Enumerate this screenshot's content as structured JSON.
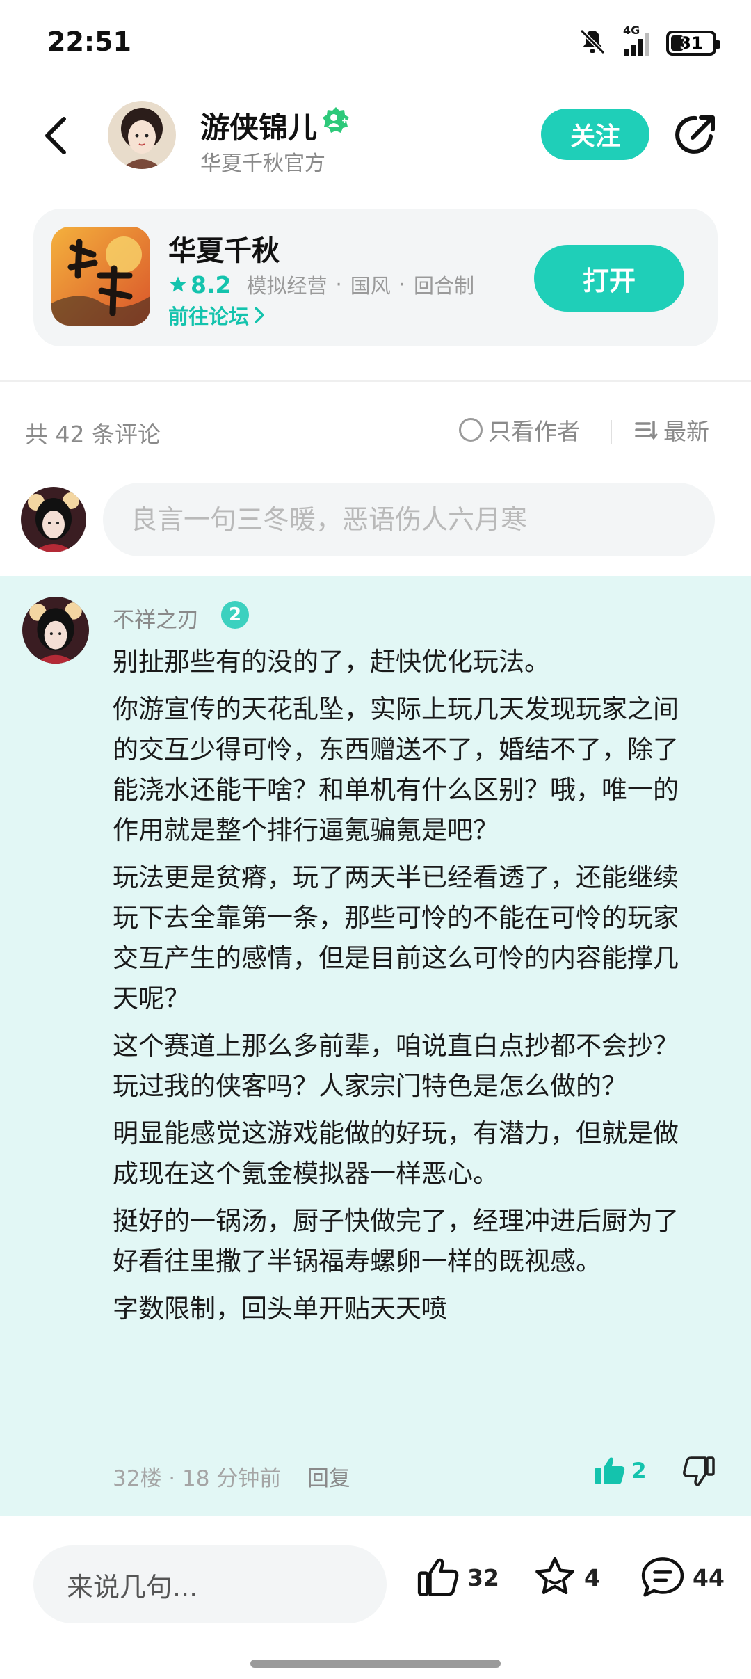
{
  "status_bar": {
    "time": "22:51",
    "network": "4G",
    "battery": "31",
    "battery_level_percent": 31
  },
  "header": {
    "author_name": "游侠锦儿",
    "author_subtitle": "华夏千秋官方",
    "follow_label": "关注",
    "icons": {
      "back": "chevron-left-icon",
      "share": "share-icon",
      "verified": "verified-badge-icon"
    }
  },
  "game_card": {
    "title": "华夏千秋",
    "rating": "8.2",
    "tags": [
      "模拟经营",
      "国风",
      "回合制"
    ],
    "forum_link": "前往论坛",
    "open_label": "打开"
  },
  "comments_bar": {
    "count_text": "共 42 条评论",
    "author_only_label": "只看作者",
    "sort_label": "最新"
  },
  "comment_input": {
    "placeholder": "良言一句三冬暖，恶语伤人六月寒"
  },
  "comment": {
    "user_name": "不祥之刃",
    "level": "2",
    "paragraphs": [
      "别扯那些有的没的了，赶快优化玩法。",
      "你游宣传的天花乱坠，实际上玩几天发现玩家之间的交互少得可怜，东西赠送不了，婚结不了，除了能浇水还能干啥？和单机有什么区别？哦，唯一的作用就是整个排行逼氪骗氪是吧？",
      "玩法更是贫瘠，玩了两天半已经看透了，还能继续玩下去全靠第一条，那些可怜的不能在可怜的玩家交互产生的感情，但是目前这么可怜的内容能撑几天呢？",
      "这个赛道上那么多前辈，咱说直白点抄都不会抄？玩过我的侠客吗？人家宗门特色是怎么做的？",
      "明显能感觉这游戏能做的好玩，有潜力，但就是做成现在这个氪金模拟器一样恶心。",
      "挺好的一锅汤，厨子快做完了，经理冲进后厨为了好看往里撒了半锅福寿螺卵一样的既视感。",
      "字数限制，回头单开贴天天喷"
    ],
    "floor_time": "32楼 · 18 分钟前",
    "reply_label": "回复",
    "likes": "2"
  },
  "bottom_bar": {
    "input_placeholder": "来说几句...",
    "like_count": "32",
    "favorite_count": "4",
    "comment_count": "44"
  },
  "colors": {
    "accent": "#1fcfb8",
    "accent_text": "#14c3ad",
    "comment_bg": "#e2f7f5",
    "card_bg": "#f3f5f6"
  }
}
